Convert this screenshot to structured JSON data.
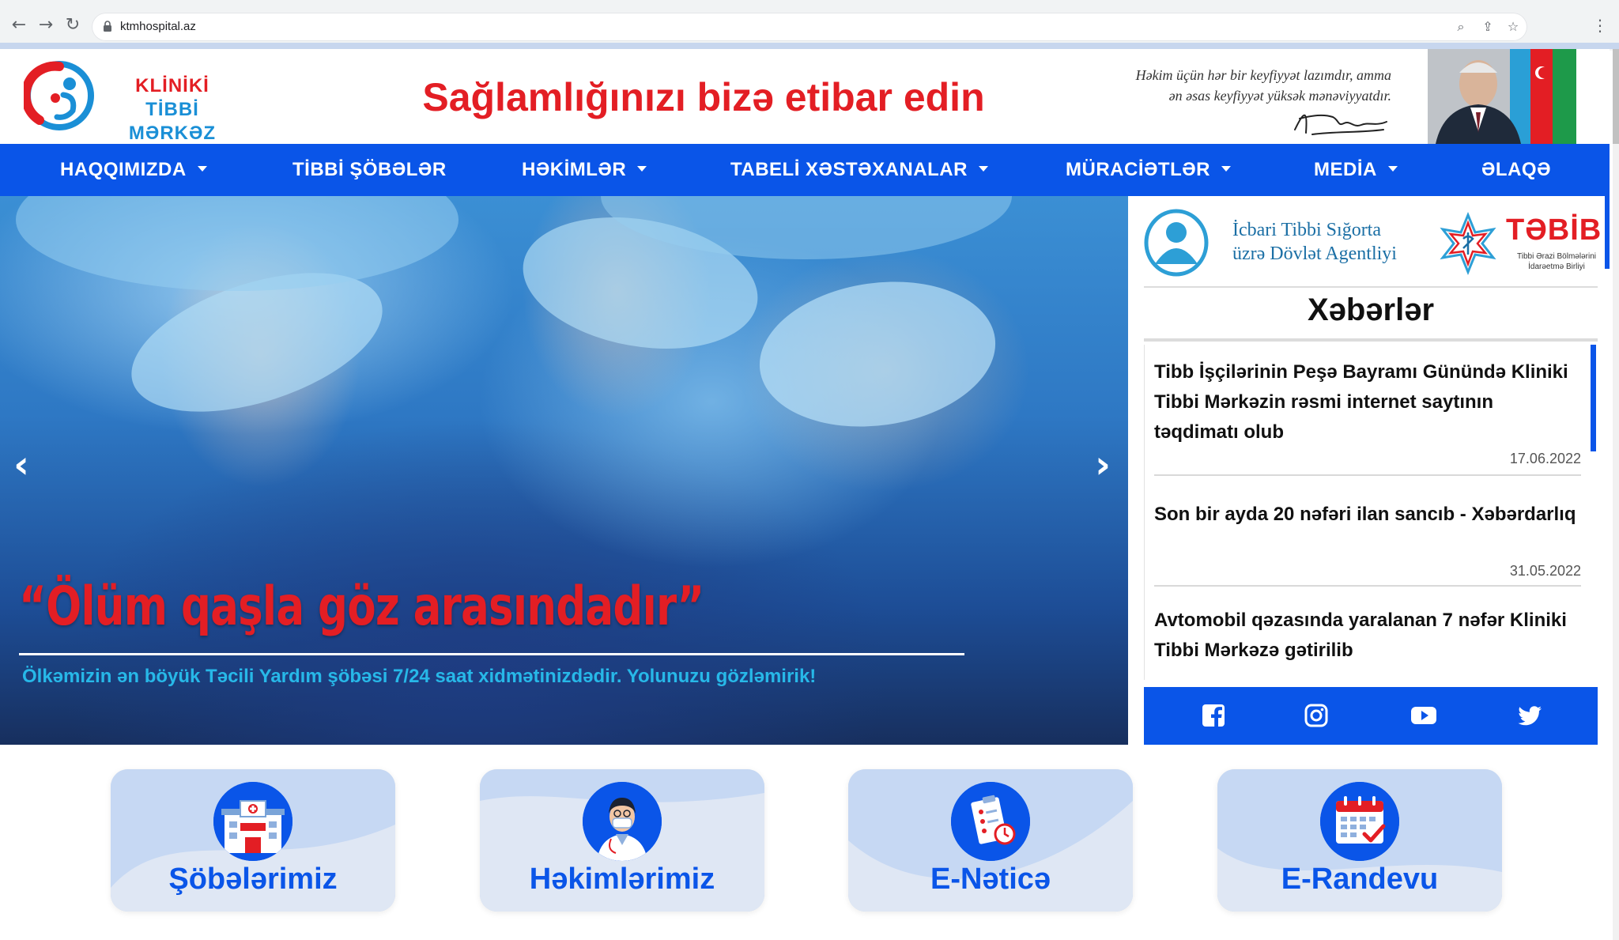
{
  "browser": {
    "url": "ktmhospital.az",
    "back_icon": "arrow-left-icon",
    "forward_icon": "arrow-right-icon",
    "reload_icon": "reload-icon"
  },
  "header": {
    "logo_line1": "KLİNİKİ",
    "logo_line2": "TİBBİ MƏRKƏZ",
    "slogan": "Sağlamlığınızı bizə etibar edin",
    "quote_line1": "Həkim üçün hər bir keyfiyyət lazımdır, amma",
    "quote_line2": "ən əsas keyfiyyət yüksək mənəviyyatdır."
  },
  "nav": {
    "items": [
      {
        "label": "HAQQIMIZDA",
        "has_dropdown": true
      },
      {
        "label": "TİBBİ ŞÖBƏLƏR",
        "has_dropdown": false
      },
      {
        "label": "HƏKİMLƏR",
        "has_dropdown": true
      },
      {
        "label": "TABELİ XƏSTƏXANALAR",
        "has_dropdown": true
      },
      {
        "label": "MÜRACİƏTLƏR",
        "has_dropdown": true
      },
      {
        "label": "MEDİA",
        "has_dropdown": true
      },
      {
        "label": "ƏLAQƏ",
        "has_dropdown": false
      }
    ]
  },
  "hero": {
    "title": "“Ölüm qaşla göz arasındadır”",
    "subtitle": "Ölkəmizin ən böyük Təcili Yardım şöbəsi 7/24 saat xidmətinizdədir. Yolunuzu gözləmirik!",
    "prev_icon": "chevron-left-icon",
    "next_icon": "chevron-right-icon"
  },
  "sidebar": {
    "partner1_line1": "İcbari Tibbi Sığorta",
    "partner1_line2": "üzrə Dövlət Agentliyi",
    "partner2_name": "TƏBİB",
    "partner2_sub_line1": "Tibbi Ərazi Bölmələrini",
    "partner2_sub_line2": "İdarəetmə Birliyi",
    "news_heading": "Xəbərlər",
    "news": [
      {
        "title": "Tibb İşçilərinin Peşə Bayramı Günündə Kliniki Tibbi Mərkəzin rəsmi internet saytının təqdimatı olub",
        "date": "17.06.2022"
      },
      {
        "title": "Son bir ayda 20 nəfəri ilan sancıb - Xəbərdarlıq",
        "date": "31.05.2022"
      },
      {
        "title": "Avtomobil qəzasında yaralanan 7 nəfər Kliniki Tibbi Mərkəzə gətirilib",
        "date": ""
      }
    ],
    "social": [
      "facebook-icon",
      "instagram-icon",
      "youtube-icon",
      "twitter-icon"
    ]
  },
  "cards": [
    {
      "label": "Şöbələrimiz",
      "icon": "hospital-building-icon"
    },
    {
      "label": "Həkimlərimiz",
      "icon": "doctor-icon"
    },
    {
      "label": "E-Nəticə",
      "icon": "clipboard-results-icon"
    },
    {
      "label": "E-Randevu",
      "icon": "calendar-check-icon"
    }
  ],
  "colors": {
    "brand_blue": "#0a55e8",
    "brand_red": "#e31e24",
    "accent_cyan": "#27b8e8"
  }
}
